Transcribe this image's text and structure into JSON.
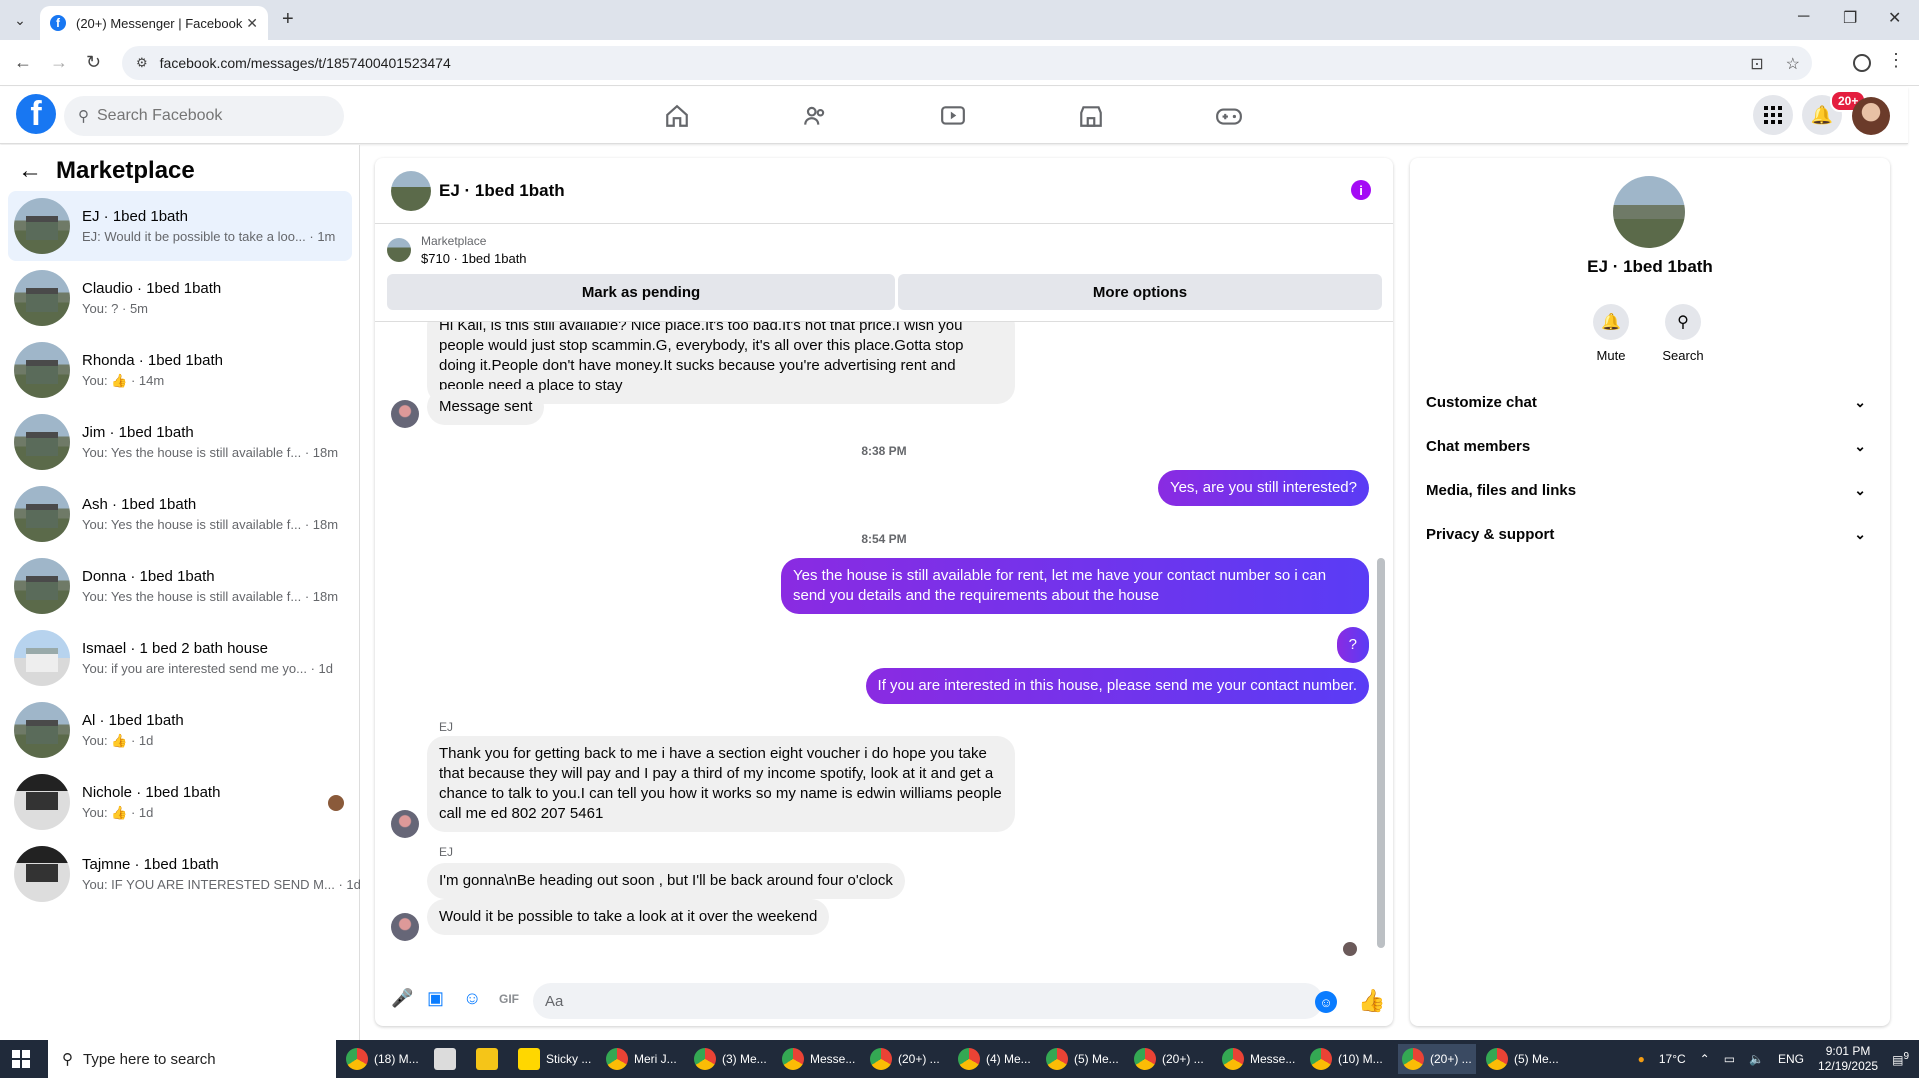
{
  "browser": {
    "tab_title": "(20+) Messenger | Facebook",
    "url": "facebook.com/messages/t/1857400401523474"
  },
  "header": {
    "search_placeholder": "Search Facebook",
    "notification_badge": "20+"
  },
  "left": {
    "title": "Marketplace",
    "conversations": [
      {
        "name": "EJ · 1bed 1bath",
        "preview": "EJ: Would it be possible to take a loo... · 1m",
        "active": true
      },
      {
        "name": "Claudio · 1bed 1bath",
        "preview": "You: ? · 5m"
      },
      {
        "name": "Rhonda · 1bed 1bath",
        "preview": "You: 👍 · 14m"
      },
      {
        "name": "Jim · 1bed 1bath",
        "preview": "You: Yes the house is still available f... · 18m"
      },
      {
        "name": "Ash · 1bed 1bath",
        "preview": "You: Yes the house is still available f... · 18m"
      },
      {
        "name": "Donna · 1bed 1bath",
        "preview": "You: Yes the house is still available f... · 18m"
      },
      {
        "name": "Ismael · 1 bed 2 bath house",
        "preview": "You: if you are interested send me yo... · 1d"
      },
      {
        "name": "Al · 1bed 1bath",
        "preview": "You: 👍 · 1d"
      },
      {
        "name": "Nichole · 1bed 1bath",
        "preview": "You: 👍 · 1d"
      },
      {
        "name": "Tajmne · 1bed 1bath",
        "preview": "You: IF YOU ARE INTERESTED SEND M... · 1d"
      }
    ]
  },
  "chat": {
    "title": "EJ · 1bed 1bath",
    "marketplace_label": "Marketplace",
    "listing": "$710 · 1bed 1bath",
    "mark_pending": "Mark as pending",
    "more_options": "More options",
    "messages": {
      "m1": "Hi Kali, is this still available? Nice place.It's too bad.It's not that price.I wish you people would just stop scammin.G, everybody, it's all over this place.Gotta stop doing it.People don't have money.It sucks because you're advertising rent and people need a place to stay",
      "m2": "Message sent",
      "t1": "8:38 PM",
      "m3": "Yes, are you still interested?",
      "t2": "8:54 PM",
      "m4": "Yes the house is still available for rent, let me have your contact number so i can send you details and the requirements about the house",
      "m5": "?",
      "m6": "If you are interested in this house, please send me your contact number.",
      "s1": "EJ",
      "m7": "Thank you for getting back to me  i have a section eight voucher i do hope you take that because they will pay and I pay a third of my income spotify, look at it and get a chance to talk to you.I can tell you how it works  so my name is edwin williams people call me ed  802 207 5461",
      "s2": "EJ",
      "m8": "I'm gonna\\nBe heading out soon , but I'll be back around four o'clock",
      "m9": "Would it be possible to take a look at it over the weekend"
    },
    "composer_placeholder": "Aa"
  },
  "right": {
    "name": "EJ · 1bed 1bath",
    "mute": "Mute",
    "search": "Search",
    "sections": [
      "Customize chat",
      "Chat members",
      "Media, files and links",
      "Privacy & support"
    ]
  },
  "taskbar": {
    "search": "Type here to search",
    "items": [
      "(18) M...",
      "",
      "",
      "Sticky ...",
      "Meri J...",
      "(3) Me...",
      "Messe...",
      "(20+) ...",
      "(4) Me...",
      "(5) Me...",
      "(20+) ...",
      "Messe...",
      "(10) M...",
      "(20+) ...",
      "(5) Me..."
    ],
    "temp": "17°C",
    "lang": "ENG",
    "time": "9:01 PM",
    "date": "12/19/2025",
    "notif": "9"
  }
}
